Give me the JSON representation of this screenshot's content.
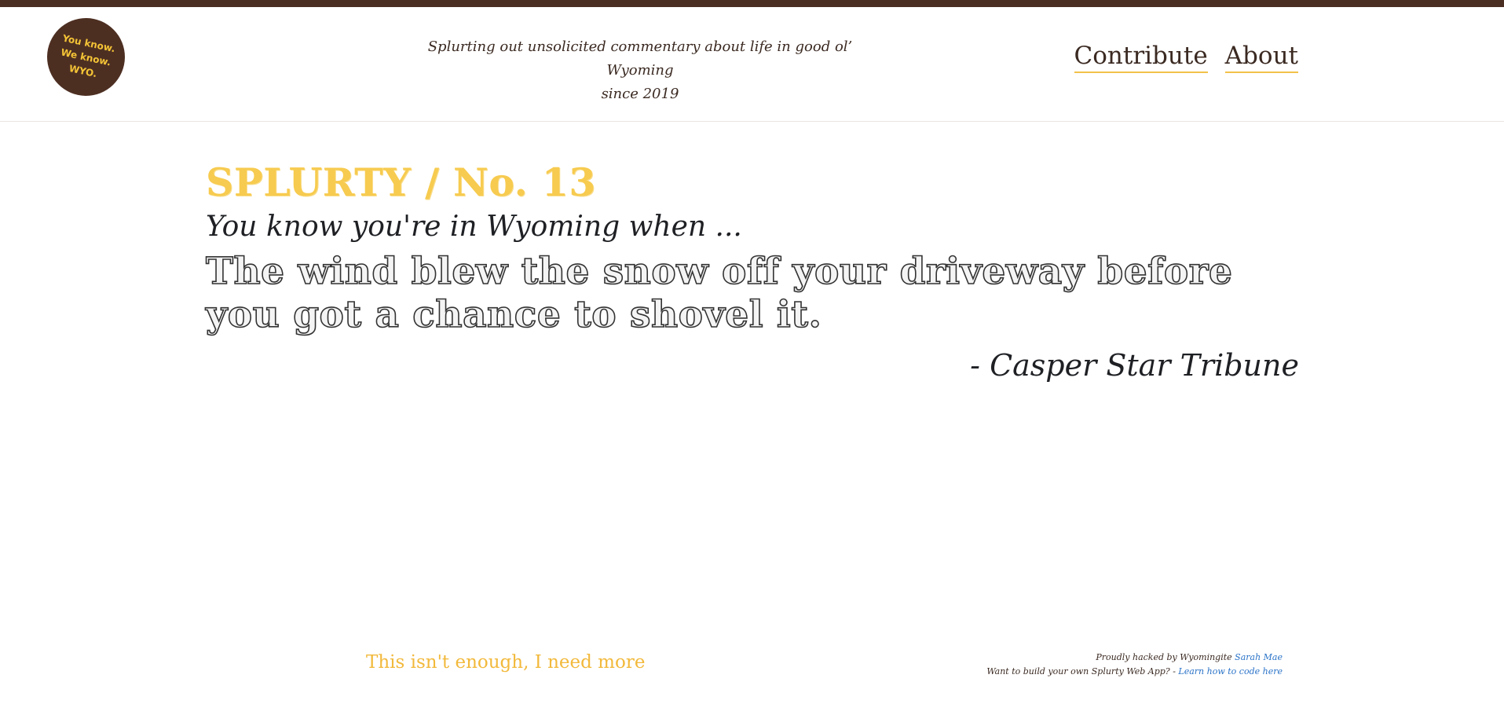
{
  "header": {
    "logo": {
      "lines": [
        "You know.",
        "We know.",
        "WYO."
      ]
    },
    "tagline_line1": "Splurting out unsolicited commentary about life in good ol’ Wyoming",
    "tagline_line2": "since 2019",
    "nav": {
      "contribute": "Contribute",
      "about": "About"
    }
  },
  "main": {
    "title": "SPLURTY / No. 13",
    "intro": "You know you're in Wyoming when ...",
    "quote": "The wind blew the snow off your driveway before you got a chance to shovel it.",
    "attribution": "- Casper Star Tribune"
  },
  "footer": {
    "more_link": "This isn't enough, I need more",
    "credit_prefix": "Proudly hacked by Wyomingite ",
    "credit_author": "Sarah Mae",
    "build_prefix": "Want to build your own Splurty Web App? - ",
    "build_link": "Learn how to code here"
  },
  "colors": {
    "brand_brown": "#4a2e22",
    "accent_yellow": "#f7cb4f",
    "link_blue": "#2a73c8"
  }
}
